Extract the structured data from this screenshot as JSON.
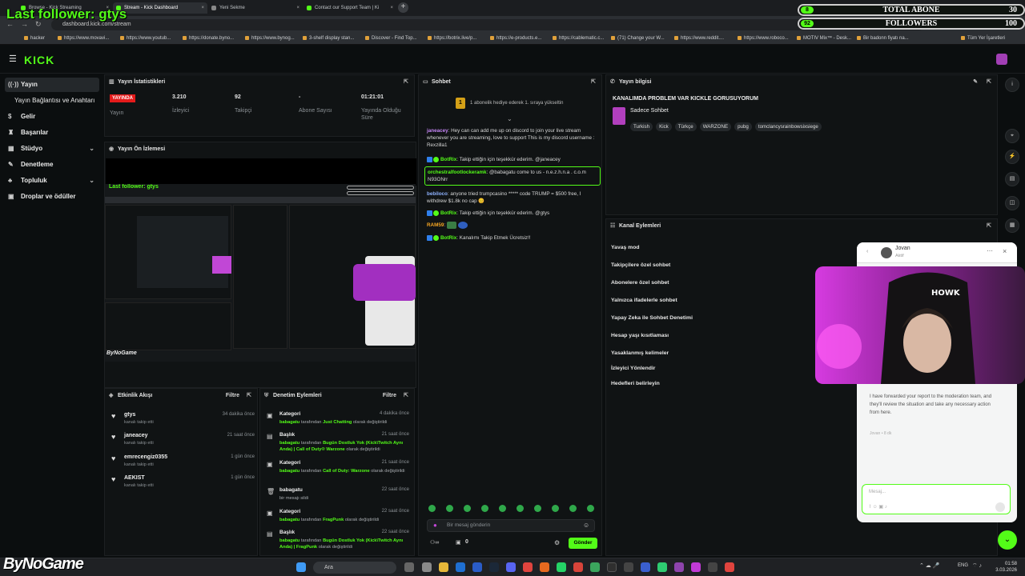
{
  "overlay": {
    "last_follower": "Last follower: gtys",
    "abone": {
      "count": "8",
      "label": "TOTAL ABONE",
      "right": "30"
    },
    "followers": {
      "count": "92",
      "label": "FOLLOWERS",
      "right": "100"
    }
  },
  "browser": {
    "tabs": [
      {
        "label": "Browse - Kick Streaming"
      },
      {
        "label": "Stream - Kick Dashboard"
      },
      {
        "label": "Yeni Sekme"
      },
      {
        "label": "Contact our Support Team | Ki"
      }
    ],
    "url": "dashboard.kick.com/stream",
    "bookmarks": [
      "hacker",
      "https://www.movavi...",
      "https://www.youtub...",
      "https://donate.byno...",
      "https://www.bynog...",
      "3-shelf display stan...",
      "Discover - Find Top...",
      "https://botrix.live/p...",
      "https://e-products.e...",
      "https://cablematic.c...",
      "(71) Change your W...",
      "https://www.reddit....",
      "https://www.roboco...",
      "MOTIV Mix™ - Desk...",
      "Bir badonn fiyatı na..."
    ],
    "bookmarks_all": "Tüm Yer İşaretleri"
  },
  "brand": {
    "logo": "KICK",
    "accent": "#53fc18"
  },
  "sidebar": {
    "items": [
      {
        "label": "Yayın",
        "icon": "broadcast-icon"
      },
      {
        "label": "Yayın Bağlantısı ve Anahtarı",
        "icon": ""
      },
      {
        "label": "Gelir",
        "icon": "dollar-icon"
      },
      {
        "label": "Başarılar",
        "icon": "trophy-icon"
      },
      {
        "label": "Stüdyo",
        "icon": "studio-icon"
      },
      {
        "label": "Denetleme",
        "icon": "wrench-icon"
      },
      {
        "label": "Topluluk",
        "icon": "community-icon"
      },
      {
        "label": "Droplar ve ödüller",
        "icon": "gift-icon"
      }
    ]
  },
  "stats": {
    "title": "Yayın İstatistikleri",
    "items": [
      {
        "value": "YAYINDA",
        "label": "Yayın"
      },
      {
        "value": "3.210",
        "label": "İzleyici"
      },
      {
        "value": "92",
        "label": "Takipçi"
      },
      {
        "value": "-",
        "label": "Abone Sayısı"
      },
      {
        "value": "01:21:01",
        "label": "Yayında Olduğu Süre"
      }
    ]
  },
  "preview": {
    "title": "Yayın Ön İzlemesi",
    "inner_follower": "Last follower: gtys",
    "inner_watermark": "ByNoGame"
  },
  "activity": {
    "title": "Etkinlik Akışı",
    "filter": "Filtre",
    "items": [
      {
        "name": "gtys",
        "sub": "kanalı takip etti",
        "time": "34 dakika önce"
      },
      {
        "name": "janeacey",
        "sub": "kanalı takip etti",
        "time": "21 saat önce"
      },
      {
        "name": "emrecengiz0355",
        "sub": "kanalı takip etti",
        "time": "1 gün önce"
      },
      {
        "name": "AEKIST",
        "sub": "kanalı takip etti",
        "time": "1 gün önce"
      }
    ]
  },
  "modlog": {
    "title": "Denetim Eylemleri",
    "filter": "Filtre",
    "items": [
      {
        "type": "Kategori",
        "time": "4 dakika önce",
        "user": "babagatu",
        "mid": " tarafından ",
        "val": "Just Chatting",
        "end": " olarak değiştirildi"
      },
      {
        "type": "Başlık",
        "time": "21 saat önce",
        "user": "babagatu",
        "mid": " tarafından ",
        "val": "Bugün Dostluk Yok (Kick\\Twitch Aynı Anda) | Call of Duty® Warzone",
        "end": " olarak değiştirildi"
      },
      {
        "type": "Kategori",
        "time": "21 saat önce",
        "user": "babagatu",
        "mid": " tarafından ",
        "val": "Call of Duty: Warzone",
        "end": " olarak değiştirildi"
      },
      {
        "type": "babagatu",
        "time": "22 saat önce",
        "user": "",
        "mid": "bir mesajı sildi",
        "val": "",
        "end": ""
      },
      {
        "type": "Kategori",
        "time": "22 saat önce",
        "user": "babagatu",
        "mid": " tarafından ",
        "val": "FragPunk",
        "end": " olarak değiştirildi"
      },
      {
        "type": "Başlık",
        "time": "22 saat önce",
        "user": "babagatu",
        "mid": " tarafından ",
        "val": "Bugün Dostluk Yok (Kick\\Twitch Aynı Anda) | FragPunk",
        "end": " olarak değiştirildi"
      }
    ]
  },
  "chat": {
    "title": "Sohbet",
    "pinned": "1 abonelik hediye ederek 1. sıraya yükseltin",
    "messages": [
      {
        "user": "janeacey",
        "color": "#c586f5",
        "text": "Hey can can add me up on discord to join your live stream whenever you are streaming, love to support This is my discord username : Rexzilla1",
        "bot": false,
        "hl": false
      },
      {
        "user": "BotRix",
        "color": "#53fc18",
        "text": "Takip ettiğin için teşekkür ederim. @janeacey",
        "bot": true,
        "hl": false
      },
      {
        "user": "orchestralfootlockeramk",
        "color": "#53fc18",
        "text": "@babagatu come to us - n.e.z.h.n.a . c.o.m N93ONrr",
        "bot": false,
        "hl": true
      },
      {
        "user": "bebiloco",
        "color": "#8fb3ff",
        "text": "anyone tried trumpcasino ***** code TRUMP = $500 free, I withdrew $1.8k no cap 😊",
        "bot": false,
        "hl": false
      },
      {
        "user": "BotRix",
        "color": "#53fc18",
        "text": "Takip ettiğin için teşekkür ederim. @gtys",
        "bot": true,
        "hl": false
      },
      {
        "user": "RAM59",
        "color": "#f5a623",
        "text": "",
        "bot": false,
        "hl": false
      },
      {
        "user": "BotRix",
        "color": "#53fc18",
        "text": "Kanalımı Takip Etmek Ücretsiz!!",
        "bot": true,
        "hl": false
      }
    ],
    "input_placeholder": "Bir mesaj gönderin",
    "send": "Gönder",
    "count": "0"
  },
  "info": {
    "title": "Yayın bilgisi",
    "stream_title": "KANALIMDA PROBLEM VAR KICKLE GORUSUYORUM",
    "category": "Sadece Sohbet",
    "tags": [
      "Turkish",
      "Kick",
      "Türkçe",
      "WARZONE",
      "pubg",
      "tomclancysrainbowsixsiege"
    ]
  },
  "actions": {
    "title": "Kanal Eylemleri",
    "items": [
      "Yavaş mod",
      "Takipçilere özel sohbet",
      "Abonelere özel sohbet",
      "Yalnızca ifadelerle sohbet",
      "Yapay Zeka ile Sohbet Denetimi",
      "Hesap yaşı kısıtlaması",
      "Yasaklanmış kelimeler",
      "İzleyici Yönlendir",
      "Hedefleri belirleyin"
    ]
  },
  "support": {
    "agent": "Jovan",
    "status": "Aktif",
    "message": "I have forwarded your report to the moderation team, and they'll review the situation and take any necessary action from here.",
    "meta": "Jovan • 8 dk",
    "input_placeholder": "Mesaj..."
  },
  "taskbar": {
    "search": "Ara",
    "lang": "ENG",
    "time": "01:58",
    "date": "3.03.2026"
  },
  "watermark": "ByNoGame"
}
